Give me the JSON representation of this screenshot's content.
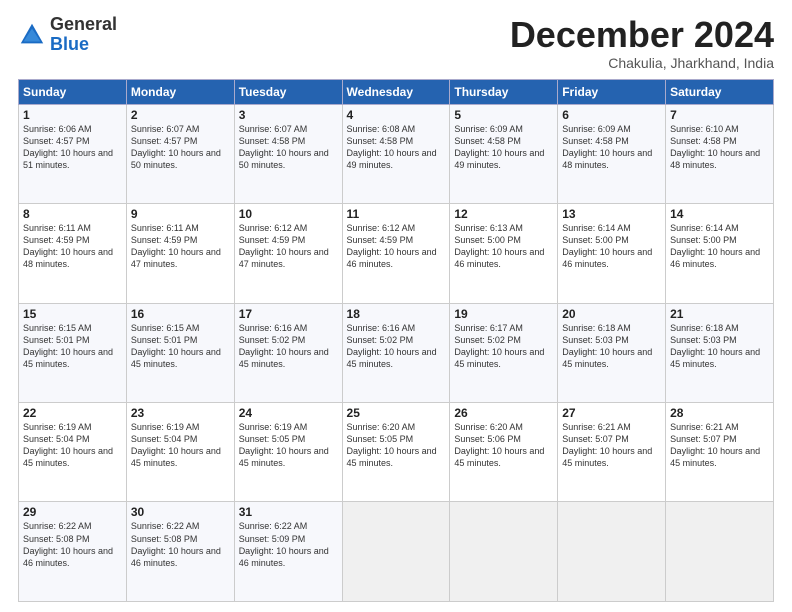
{
  "logo": {
    "general": "General",
    "blue": "Blue"
  },
  "header": {
    "month": "December 2024",
    "location": "Chakulia, Jharkhand, India"
  },
  "weekdays": [
    "Sunday",
    "Monday",
    "Tuesday",
    "Wednesday",
    "Thursday",
    "Friday",
    "Saturday"
  ],
  "weeks": [
    [
      {
        "day": "1",
        "sunrise": "Sunrise: 6:06 AM",
        "sunset": "Sunset: 4:57 PM",
        "daylight": "Daylight: 10 hours and 51 minutes."
      },
      {
        "day": "2",
        "sunrise": "Sunrise: 6:07 AM",
        "sunset": "Sunset: 4:57 PM",
        "daylight": "Daylight: 10 hours and 50 minutes."
      },
      {
        "day": "3",
        "sunrise": "Sunrise: 6:07 AM",
        "sunset": "Sunset: 4:58 PM",
        "daylight": "Daylight: 10 hours and 50 minutes."
      },
      {
        "day": "4",
        "sunrise": "Sunrise: 6:08 AM",
        "sunset": "Sunset: 4:58 PM",
        "daylight": "Daylight: 10 hours and 49 minutes."
      },
      {
        "day": "5",
        "sunrise": "Sunrise: 6:09 AM",
        "sunset": "Sunset: 4:58 PM",
        "daylight": "Daylight: 10 hours and 49 minutes."
      },
      {
        "day": "6",
        "sunrise": "Sunrise: 6:09 AM",
        "sunset": "Sunset: 4:58 PM",
        "daylight": "Daylight: 10 hours and 48 minutes."
      },
      {
        "day": "7",
        "sunrise": "Sunrise: 6:10 AM",
        "sunset": "Sunset: 4:58 PM",
        "daylight": "Daylight: 10 hours and 48 minutes."
      }
    ],
    [
      {
        "day": "8",
        "sunrise": "Sunrise: 6:11 AM",
        "sunset": "Sunset: 4:59 PM",
        "daylight": "Daylight: 10 hours and 48 minutes."
      },
      {
        "day": "9",
        "sunrise": "Sunrise: 6:11 AM",
        "sunset": "Sunset: 4:59 PM",
        "daylight": "Daylight: 10 hours and 47 minutes."
      },
      {
        "day": "10",
        "sunrise": "Sunrise: 6:12 AM",
        "sunset": "Sunset: 4:59 PM",
        "daylight": "Daylight: 10 hours and 47 minutes."
      },
      {
        "day": "11",
        "sunrise": "Sunrise: 6:12 AM",
        "sunset": "Sunset: 4:59 PM",
        "daylight": "Daylight: 10 hours and 46 minutes."
      },
      {
        "day": "12",
        "sunrise": "Sunrise: 6:13 AM",
        "sunset": "Sunset: 5:00 PM",
        "daylight": "Daylight: 10 hours and 46 minutes."
      },
      {
        "day": "13",
        "sunrise": "Sunrise: 6:14 AM",
        "sunset": "Sunset: 5:00 PM",
        "daylight": "Daylight: 10 hours and 46 minutes."
      },
      {
        "day": "14",
        "sunrise": "Sunrise: 6:14 AM",
        "sunset": "Sunset: 5:00 PM",
        "daylight": "Daylight: 10 hours and 46 minutes."
      }
    ],
    [
      {
        "day": "15",
        "sunrise": "Sunrise: 6:15 AM",
        "sunset": "Sunset: 5:01 PM",
        "daylight": "Daylight: 10 hours and 45 minutes."
      },
      {
        "day": "16",
        "sunrise": "Sunrise: 6:15 AM",
        "sunset": "Sunset: 5:01 PM",
        "daylight": "Daylight: 10 hours and 45 minutes."
      },
      {
        "day": "17",
        "sunrise": "Sunrise: 6:16 AM",
        "sunset": "Sunset: 5:02 PM",
        "daylight": "Daylight: 10 hours and 45 minutes."
      },
      {
        "day": "18",
        "sunrise": "Sunrise: 6:16 AM",
        "sunset": "Sunset: 5:02 PM",
        "daylight": "Daylight: 10 hours and 45 minutes."
      },
      {
        "day": "19",
        "sunrise": "Sunrise: 6:17 AM",
        "sunset": "Sunset: 5:02 PM",
        "daylight": "Daylight: 10 hours and 45 minutes."
      },
      {
        "day": "20",
        "sunrise": "Sunrise: 6:18 AM",
        "sunset": "Sunset: 5:03 PM",
        "daylight": "Daylight: 10 hours and 45 minutes."
      },
      {
        "day": "21",
        "sunrise": "Sunrise: 6:18 AM",
        "sunset": "Sunset: 5:03 PM",
        "daylight": "Daylight: 10 hours and 45 minutes."
      }
    ],
    [
      {
        "day": "22",
        "sunrise": "Sunrise: 6:19 AM",
        "sunset": "Sunset: 5:04 PM",
        "daylight": "Daylight: 10 hours and 45 minutes."
      },
      {
        "day": "23",
        "sunrise": "Sunrise: 6:19 AM",
        "sunset": "Sunset: 5:04 PM",
        "daylight": "Daylight: 10 hours and 45 minutes."
      },
      {
        "day": "24",
        "sunrise": "Sunrise: 6:19 AM",
        "sunset": "Sunset: 5:05 PM",
        "daylight": "Daylight: 10 hours and 45 minutes."
      },
      {
        "day": "25",
        "sunrise": "Sunrise: 6:20 AM",
        "sunset": "Sunset: 5:05 PM",
        "daylight": "Daylight: 10 hours and 45 minutes."
      },
      {
        "day": "26",
        "sunrise": "Sunrise: 6:20 AM",
        "sunset": "Sunset: 5:06 PM",
        "daylight": "Daylight: 10 hours and 45 minutes."
      },
      {
        "day": "27",
        "sunrise": "Sunrise: 6:21 AM",
        "sunset": "Sunset: 5:07 PM",
        "daylight": "Daylight: 10 hours and 45 minutes."
      },
      {
        "day": "28",
        "sunrise": "Sunrise: 6:21 AM",
        "sunset": "Sunset: 5:07 PM",
        "daylight": "Daylight: 10 hours and 45 minutes."
      }
    ],
    [
      {
        "day": "29",
        "sunrise": "Sunrise: 6:22 AM",
        "sunset": "Sunset: 5:08 PM",
        "daylight": "Daylight: 10 hours and 46 minutes."
      },
      {
        "day": "30",
        "sunrise": "Sunrise: 6:22 AM",
        "sunset": "Sunset: 5:08 PM",
        "daylight": "Daylight: 10 hours and 46 minutes."
      },
      {
        "day": "31",
        "sunrise": "Sunrise: 6:22 AM",
        "sunset": "Sunset: 5:09 PM",
        "daylight": "Daylight: 10 hours and 46 minutes."
      },
      null,
      null,
      null,
      null
    ]
  ]
}
